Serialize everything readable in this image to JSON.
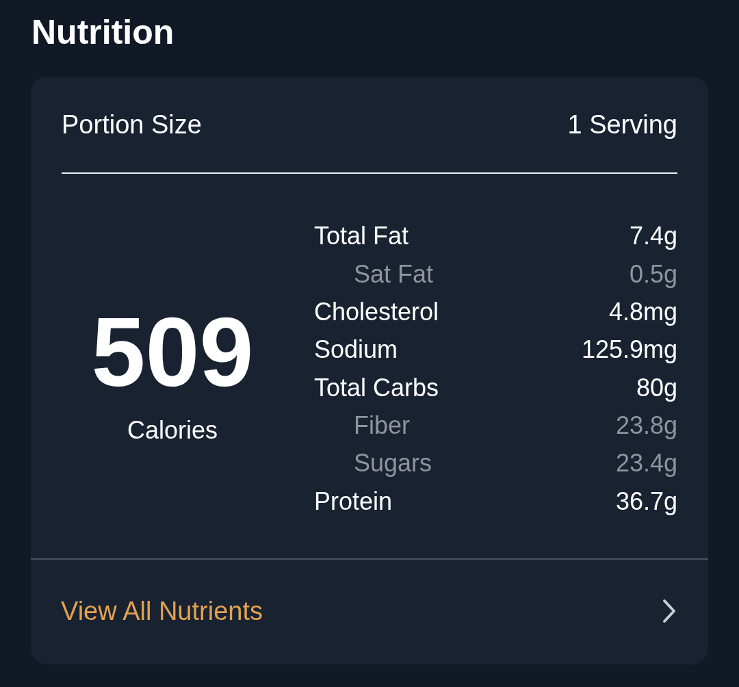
{
  "title": "Nutrition",
  "portion": {
    "label": "Portion Size",
    "value": "1 Serving"
  },
  "calories": {
    "value": "509",
    "label": "Calories"
  },
  "nutrients": [
    {
      "name": "Total Fat",
      "amount": "7.4g",
      "indented": false
    },
    {
      "name": "Sat Fat",
      "amount": "0.5g",
      "indented": true
    },
    {
      "name": "Cholesterol",
      "amount": "4.8mg",
      "indented": false
    },
    {
      "name": "Sodium",
      "amount": "125.9mg",
      "indented": false
    },
    {
      "name": "Total Carbs",
      "amount": "80g",
      "indented": false
    },
    {
      "name": "Fiber",
      "amount": "23.8g",
      "indented": true
    },
    {
      "name": "Sugars",
      "amount": "23.4g",
      "indented": true
    },
    {
      "name": "Protein",
      "amount": "36.7g",
      "indented": false
    }
  ],
  "link": {
    "label": "View All Nutrients"
  }
}
